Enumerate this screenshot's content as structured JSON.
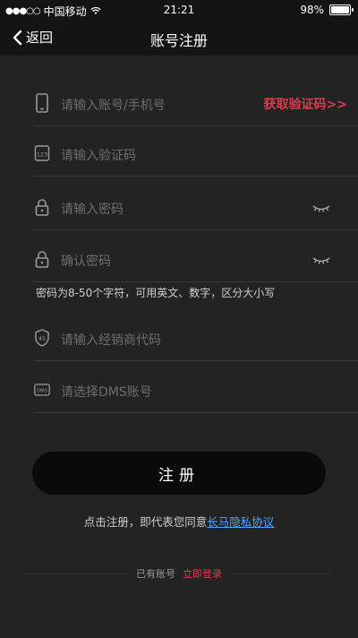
{
  "status_bar": {
    "signal": "●●●○○",
    "carrier": "中国移动",
    "time": "21:21",
    "battery_text": "98%",
    "battery_level": 0.98
  },
  "nav": {
    "back_label": "返回",
    "title": "账号注册"
  },
  "fields": {
    "account": {
      "placeholder": "请输入账号/手机号",
      "action": "获取验证码>>"
    },
    "code": {
      "placeholder": "请输入验证码"
    },
    "password": {
      "placeholder": "请输入密码"
    },
    "confirm": {
      "placeholder": "确认密码"
    },
    "password_hint": "密码为8-50个字符，可用英文、数字，区分大小写",
    "dealer": {
      "placeholder": "请输入经销商代码"
    },
    "dms": {
      "placeholder": "请选择DMS账号"
    }
  },
  "register_button": "注册",
  "agreement": {
    "text": "点击注册，即代表您同意",
    "link": "长马隐私协议"
  },
  "login": {
    "prompt": "已有账号",
    "link": "立即登录"
  },
  "colors": {
    "accent_red": "#e03a4e",
    "link_blue": "#4ea7ff",
    "background": "#232323"
  }
}
